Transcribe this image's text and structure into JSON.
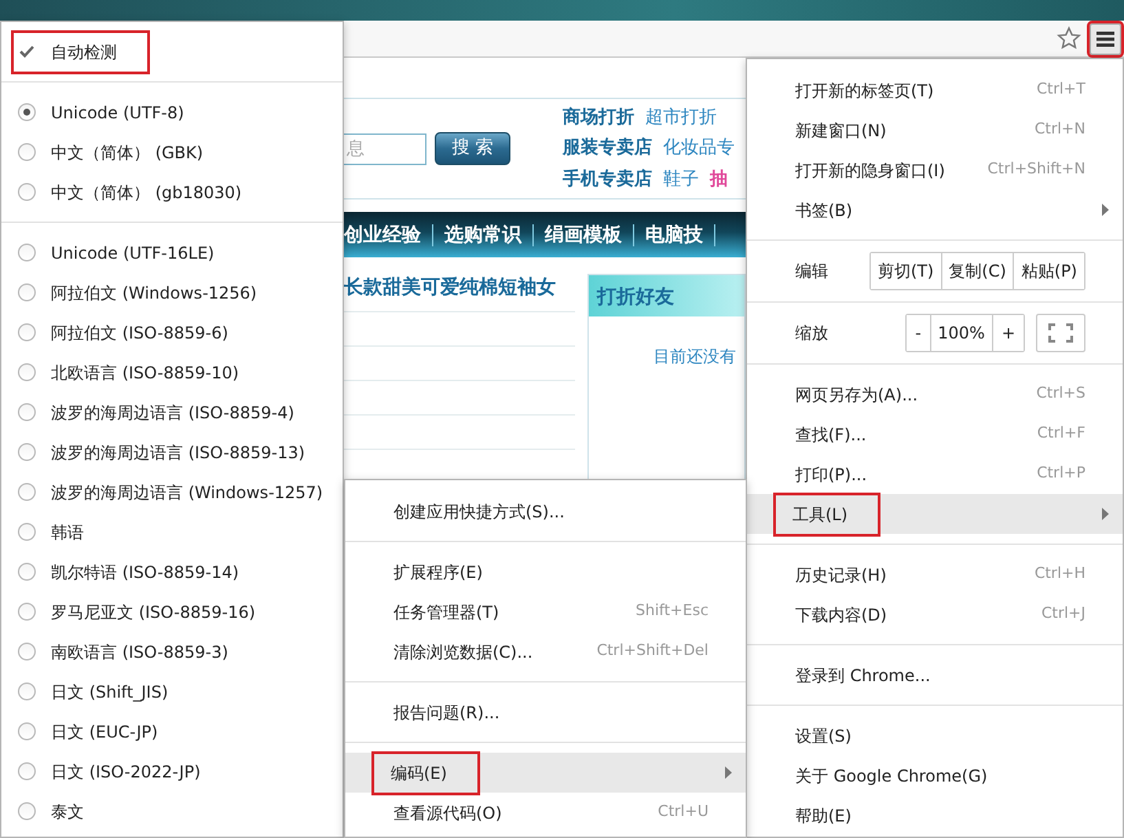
{
  "toolbar": {
    "menu_button": {
      "annotated": true
    }
  },
  "web_page": {
    "search": {
      "placeholder": "息",
      "button": "搜 索"
    },
    "link_rows": [
      [
        {
          "text": "商场打折",
          "kind": "featured"
        },
        {
          "text": "超市打折",
          "kind": "plain"
        }
      ],
      [
        {
          "text": "服装专卖店",
          "kind": "featured"
        },
        {
          "text": "化妆品专",
          "kind": "plain"
        }
      ],
      [
        {
          "text": "手机专卖店",
          "kind": "featured"
        },
        {
          "text": "鞋子",
          "kind": "plain"
        },
        {
          "text": "抽",
          "kind": "hot"
        }
      ]
    ],
    "nav": [
      "创业经验",
      "选购常识",
      "绢画模板",
      "电脑技"
    ],
    "article_title": "长款甜美可爱纯棉短袖女",
    "panel": {
      "title": "打折好友",
      "text": "目前还没有"
    }
  },
  "encoding_menu": {
    "items": [
      {
        "kind": "check",
        "label": "自动检测",
        "checked": true,
        "annotated": true
      },
      {
        "kind": "separator"
      },
      {
        "kind": "radio",
        "label": "Unicode (UTF-8)",
        "selected": true,
        "annotated": false
      },
      {
        "kind": "radio",
        "label": "中文（简体） (GBK)",
        "selected": false,
        "annotated": false
      },
      {
        "kind": "radio",
        "label": "中文（简体） (gb18030)",
        "selected": false,
        "annotated": false
      },
      {
        "kind": "separator"
      },
      {
        "kind": "radio",
        "label": "Unicode (UTF-16LE)",
        "selected": false,
        "annotated": false
      },
      {
        "kind": "radio",
        "label": "阿拉伯文 (Windows-1256)",
        "selected": false,
        "annotated": false
      },
      {
        "kind": "radio",
        "label": "阿拉伯文 (ISO-8859-6)",
        "selected": false,
        "annotated": false
      },
      {
        "kind": "radio",
        "label": "北欧语言 (ISO-8859-10)",
        "selected": false,
        "annotated": false
      },
      {
        "kind": "radio",
        "label": "波罗的海周边语言 (ISO-8859-4)",
        "selected": false,
        "annotated": false
      },
      {
        "kind": "radio",
        "label": "波罗的海周边语言 (ISO-8859-13)",
        "selected": false,
        "annotated": false
      },
      {
        "kind": "radio",
        "label": "波罗的海周边语言 (Windows-1257)",
        "selected": false,
        "annotated": false
      },
      {
        "kind": "radio",
        "label": "韩语",
        "selected": false,
        "annotated": false
      },
      {
        "kind": "radio",
        "label": "凯尔特语 (ISO-8859-14)",
        "selected": false,
        "annotated": false
      },
      {
        "kind": "radio",
        "label": "罗马尼亚文 (ISO-8859-16)",
        "selected": false,
        "annotated": false
      },
      {
        "kind": "radio",
        "label": "南欧语言 (ISO-8859-3)",
        "selected": false,
        "annotated": false
      },
      {
        "kind": "radio",
        "label": "日文 (Shift_JIS)",
        "selected": false,
        "annotated": false
      },
      {
        "kind": "radio",
        "label": "日文 (EUC-JP)",
        "selected": false,
        "annotated": false
      },
      {
        "kind": "radio",
        "label": "日文 (ISO-2022-JP)",
        "selected": false,
        "annotated": false
      },
      {
        "kind": "radio",
        "label": "泰文",
        "selected": false,
        "annotated": false
      }
    ]
  },
  "tools_menu": {
    "items": [
      {
        "kind": "item",
        "label": "创建应用快捷方式(S)...",
        "submenu": false,
        "highlighted": false,
        "annotated": false
      },
      {
        "kind": "separator"
      },
      {
        "kind": "item",
        "label": "扩展程序(E)",
        "submenu": false,
        "highlighted": false,
        "annotated": false
      },
      {
        "kind": "item",
        "label": "任务管理器(T)",
        "shortcut": "Shift+Esc",
        "submenu": false,
        "highlighted": false,
        "annotated": false
      },
      {
        "kind": "item",
        "label": "清除浏览数据(C)...",
        "shortcut": "Ctrl+Shift+Del",
        "submenu": false,
        "highlighted": false,
        "annotated": false
      },
      {
        "kind": "separator"
      },
      {
        "kind": "item",
        "label": "报告问题(R)...",
        "submenu": false,
        "highlighted": false,
        "annotated": false
      },
      {
        "kind": "separator"
      },
      {
        "kind": "item",
        "label": "编码(E)",
        "submenu": true,
        "highlighted": true,
        "annotated": true
      },
      {
        "kind": "item",
        "label": "查看源代码(O)",
        "shortcut": "Ctrl+U",
        "submenu": false,
        "highlighted": false,
        "annotated": false
      }
    ]
  },
  "main_menu": {
    "items": [
      {
        "kind": "item",
        "label": "打开新的标签页(T)",
        "shortcut": "Ctrl+T",
        "submenu": false,
        "highlighted": false,
        "annotated": false
      },
      {
        "kind": "item",
        "label": "新建窗口(N)",
        "shortcut": "Ctrl+N",
        "submenu": false,
        "highlighted": false,
        "annotated": false
      },
      {
        "kind": "item",
        "label": "打开新的隐身窗口(I)",
        "shortcut": "Ctrl+Shift+N",
        "submenu": false,
        "highlighted": false,
        "annotated": false
      },
      {
        "kind": "item",
        "label": "书签(B)",
        "submenu": true,
        "highlighted": false,
        "annotated": false
      },
      {
        "kind": "separator"
      },
      {
        "kind": "edit_row",
        "label": "编辑",
        "buttons": [
          "剪切(T)",
          "复制(C)",
          "粘贴(P)"
        ]
      },
      {
        "kind": "separator"
      },
      {
        "kind": "zoom_row",
        "label": "缩放",
        "minus": "-",
        "zoom_text": "100%",
        "plus": "+"
      },
      {
        "kind": "separator"
      },
      {
        "kind": "item",
        "label": "网页另存为(A)...",
        "shortcut": "Ctrl+S",
        "submenu": false,
        "highlighted": false,
        "annotated": false
      },
      {
        "kind": "item",
        "label": "查找(F)...",
        "shortcut": "Ctrl+F",
        "submenu": false,
        "highlighted": false,
        "annotated": false
      },
      {
        "kind": "item",
        "label": "打印(P)...",
        "shortcut": "Ctrl+P",
        "submenu": false,
        "highlighted": false,
        "annotated": false
      },
      {
        "kind": "item",
        "label": "工具(L)",
        "submenu": true,
        "highlighted": true,
        "annotated": true
      },
      {
        "kind": "separator"
      },
      {
        "kind": "item",
        "label": "历史记录(H)",
        "shortcut": "Ctrl+H",
        "submenu": false,
        "highlighted": false,
        "annotated": false
      },
      {
        "kind": "item",
        "label": "下载内容(D)",
        "shortcut": "Ctrl+J",
        "submenu": false,
        "highlighted": false,
        "annotated": false
      },
      {
        "kind": "separator"
      },
      {
        "kind": "item",
        "label": "登录到 Chrome...",
        "submenu": false,
        "highlighted": false,
        "annotated": false
      },
      {
        "kind": "separator"
      },
      {
        "kind": "item",
        "label": "设置(S)",
        "submenu": false,
        "highlighted": false,
        "annotated": false
      },
      {
        "kind": "item",
        "label": "关于 Google Chrome(G)",
        "submenu": false,
        "highlighted": false,
        "annotated": false
      },
      {
        "kind": "item",
        "label": "帮助(E)",
        "submenu": false,
        "highlighted": false,
        "annotated": false
      }
    ]
  }
}
